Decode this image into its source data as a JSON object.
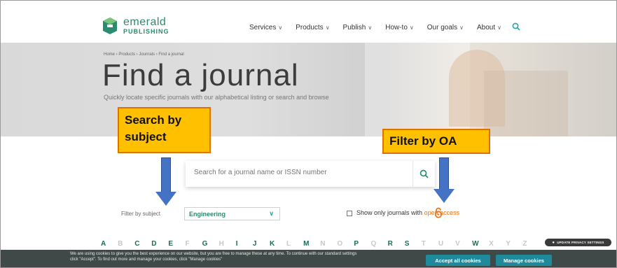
{
  "logo": {
    "name": "emerald",
    "sub": "PUBLISHING"
  },
  "nav": {
    "items": [
      {
        "label": "Services"
      },
      {
        "label": "Products"
      },
      {
        "label": "Publish"
      },
      {
        "label": "How-to"
      },
      {
        "label": "Our goals"
      },
      {
        "label": "About"
      }
    ],
    "chevron": "∨",
    "search_icon": "search-icon"
  },
  "hero": {
    "breadcrumb": "Home › Products › Journals › Find a journal",
    "title": "Find a journal",
    "description": "Quickly locate specific journals with our alphabetical listing or search and browse"
  },
  "annotations": {
    "subject": "Search by subject",
    "oa": "Filter by OA"
  },
  "search": {
    "placeholder": "Search for a journal name or ISSN number"
  },
  "filters": {
    "subject_label": "Filter by subject",
    "subject_value": "Engineering",
    "oa_label_prefix": "Show only journals with ",
    "oa_link": "open access"
  },
  "alphabet": [
    {
      "l": "A",
      "on": true
    },
    {
      "l": "B",
      "on": false
    },
    {
      "l": "C",
      "on": true
    },
    {
      "l": "D",
      "on": true
    },
    {
      "l": "E",
      "on": true
    },
    {
      "l": "F",
      "on": false
    },
    {
      "l": "G",
      "on": true
    },
    {
      "l": "H",
      "on": false
    },
    {
      "l": "I",
      "on": true
    },
    {
      "l": "J",
      "on": true
    },
    {
      "l": "K",
      "on": true
    },
    {
      "l": "L",
      "on": false
    },
    {
      "l": "M",
      "on": true
    },
    {
      "l": "N",
      "on": false
    },
    {
      "l": "O",
      "on": false
    },
    {
      "l": "P",
      "on": true
    },
    {
      "l": "Q",
      "on": false
    },
    {
      "l": "R",
      "on": true
    },
    {
      "l": "S",
      "on": true
    },
    {
      "l": "T",
      "on": false
    },
    {
      "l": "U",
      "on": false
    },
    {
      "l": "V",
      "on": false
    },
    {
      "l": "W",
      "on": true
    },
    {
      "l": "X",
      "on": false
    },
    {
      "l": "Y",
      "on": false
    },
    {
      "l": "Z",
      "on": false
    }
  ],
  "privacy_badge": "UPDATE PRIVACY SETTINGS",
  "cookie": {
    "text": "We are using cookies to give you the best experience on our website, but you are free to manage these at any time. To continue with our standard settings click \"Accept\". To find out more and manage your cookies, click \"Manage cookies\"",
    "accept": "Accept all cookies",
    "manage": "Manage cookies"
  },
  "colors": {
    "brand_green": "#2a8c6e",
    "teal": "#1f8a9b",
    "orange": "#e8741d",
    "annotation_fill": "#ffc000",
    "arrow_blue": "#4472c4"
  }
}
